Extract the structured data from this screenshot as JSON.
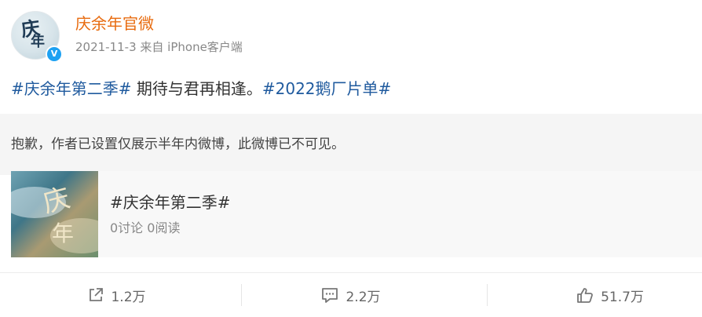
{
  "post": {
    "user": {
      "name": "庆余年官微",
      "verified_mark": "V"
    },
    "meta": "2021-11-3 来自 iPhone客户端",
    "content": {
      "tag1": "#庆余年第二季#",
      "text": " 期待与君再相逢。",
      "tag2": "#2022鹅厂片单#"
    },
    "notice": "抱歉，作者已设置仅展示半年内微博，此微博已不可见。",
    "topic_card": {
      "title": "#庆余年第二季#",
      "stats": "0讨论 0阅读"
    },
    "actions": {
      "repost": "1.2万",
      "comment": "2.2万",
      "like": "51.7万"
    }
  },
  "colors": {
    "username": "#e86b0f",
    "hashtag": "#1f5a9e",
    "verified": "#1da1f2"
  },
  "icons": [
    "share-icon",
    "comment-icon",
    "like-icon",
    "verified-icon"
  ]
}
